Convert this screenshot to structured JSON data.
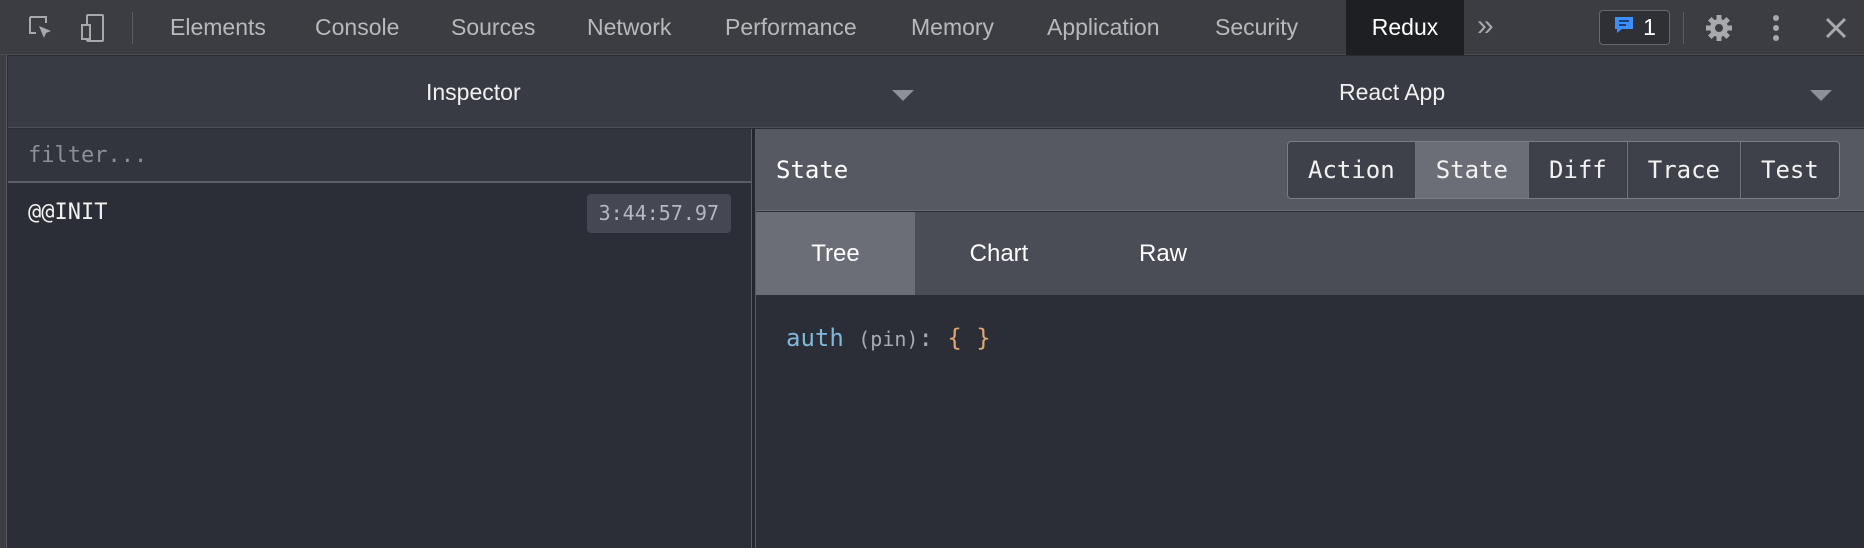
{
  "devtools": {
    "tabs": [
      {
        "label": "Elements"
      },
      {
        "label": "Console"
      },
      {
        "label": "Sources"
      },
      {
        "label": "Network"
      },
      {
        "label": "Performance"
      },
      {
        "label": "Memory"
      },
      {
        "label": "Application"
      },
      {
        "label": "Security"
      },
      {
        "label": "Redux",
        "active": true
      }
    ],
    "more_tabs_icon": "double-chevron-right",
    "issues_count": "1",
    "icons": [
      "inspect-element-icon",
      "device-toolbar-icon",
      "issues-icon",
      "settings-icon",
      "more-options-icon",
      "close-icon"
    ]
  },
  "redux": {
    "monitor_select": "Inspector",
    "instance_select": "React App",
    "filter_placeholder": "filter...",
    "actions": [
      {
        "name": "@@INIT",
        "time": "3:44:57.97"
      }
    ],
    "panel_title": "State",
    "modes": [
      "Action",
      "State",
      "Diff",
      "Trace",
      "Test"
    ],
    "active_mode": "State",
    "view_tabs": [
      "Tree",
      "Chart",
      "Raw"
    ],
    "active_view": "Tree",
    "tree": {
      "key": "auth",
      "annotation": "(pin)",
      "colon": ":",
      "value": "{ }"
    }
  },
  "colors": {
    "accent": "#7fb8de",
    "issues_blue": "#3d8eff",
    "brace": "#e2a76f"
  }
}
